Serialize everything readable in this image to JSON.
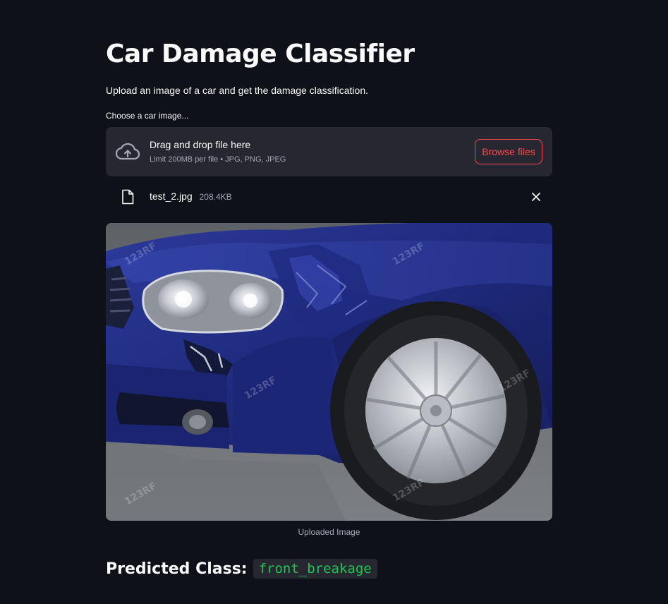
{
  "page": {
    "title": "Car Damage Classifier",
    "subtitle": "Upload an image of a car and get the damage classification."
  },
  "uploader": {
    "label": "Choose a car image...",
    "dropzone_text": "Drag and drop file here",
    "limit_text": "Limit 200MB per file • JPG, PNG, JPEG",
    "browse_label": "Browse files",
    "icon": "cloud-upload-icon",
    "accent_color": "#ff4b4b"
  },
  "file": {
    "name": "test_2.jpg",
    "size": "208.4KB",
    "icon": "file-icon",
    "remove_icon": "close-icon"
  },
  "image": {
    "caption": "Uploaded Image",
    "watermark": "123RF"
  },
  "result": {
    "label": "Predicted Class:",
    "value": "front_breakage",
    "value_color": "#21c354"
  }
}
